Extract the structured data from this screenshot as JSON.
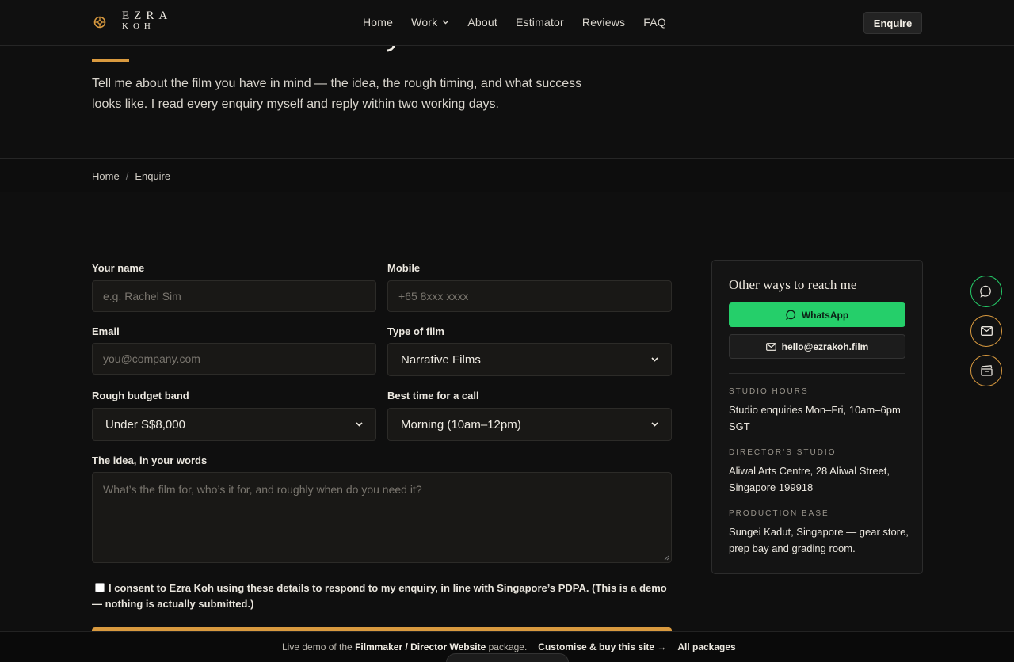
{
  "brand": {
    "line1": "EZRA",
    "line2": "KOH"
  },
  "nav": {
    "items": [
      {
        "label": "Home"
      },
      {
        "label": "Work",
        "has_dropdown": true
      },
      {
        "label": "About"
      },
      {
        "label": "Estimator"
      },
      {
        "label": "Reviews"
      },
      {
        "label": "FAQ"
      }
    ],
    "cta": "Enquire"
  },
  "hero": {
    "description": "Tell me about the film you have in mind — the idea, the rough timing, and what success looks like. I read every enquiry myself and reply within two working days."
  },
  "breadcrumb": {
    "home": "Home",
    "separator": "/",
    "current": "Enquire"
  },
  "form": {
    "name": {
      "label": "Your name",
      "placeholder": "e.g. Rachel Sim",
      "value": ""
    },
    "mobile": {
      "label": "Mobile",
      "placeholder": "+65 8xxx xxxx",
      "value": ""
    },
    "email": {
      "label": "Email",
      "placeholder": "you@company.com",
      "value": ""
    },
    "film_type": {
      "label": "Type of film",
      "value": "Narrative Films"
    },
    "budget": {
      "label": "Rough budget band",
      "value": "Under S$8,000"
    },
    "call_time": {
      "label": "Best time for a call",
      "value": "Morning (10am–12pm)"
    },
    "idea": {
      "label": "The idea, in your words",
      "placeholder": "What’s the film for, who’s it for, and roughly when do you need it?",
      "value": ""
    },
    "consent": {
      "checked": false,
      "text": "I consent to Ezra Koh using these details to respond to my enquiry, in line with Singapore’s PDPA. (This is a demo — nothing is actually submitted.)"
    }
  },
  "contact_card": {
    "title": "Other ways to reach me",
    "whatsapp_label": "WhatsApp",
    "email_label": "hello@ezrakoh.film",
    "sections": [
      {
        "label": "STUDIO HOURS",
        "text": "Studio enquiries Mon–Fri, 10am–6pm SGT"
      },
      {
        "label": "DIRECTOR’S STUDIO",
        "text": "Aliwal Arts Centre, 28 Aliwal Street, Singapore 199918"
      },
      {
        "label": "PRODUCTION BASE",
        "text": "Sungei Kadut, Singapore — gear store, prep bay and grading room."
      }
    ]
  },
  "floating_actions": [
    {
      "icon": "chat-icon"
    },
    {
      "icon": "mail-icon"
    },
    {
      "icon": "clapperboard-icon"
    }
  ],
  "footer": {
    "prefix": "Live demo of the",
    "package_name": "Filmmaker / Director Website",
    "suffix": "package.",
    "buy_link": "Customise & buy this site →",
    "all_link": "All packages"
  },
  "colors": {
    "accent": "#d99a3f",
    "whatsapp": "#25cf6a",
    "background": "#0f0f0f"
  }
}
